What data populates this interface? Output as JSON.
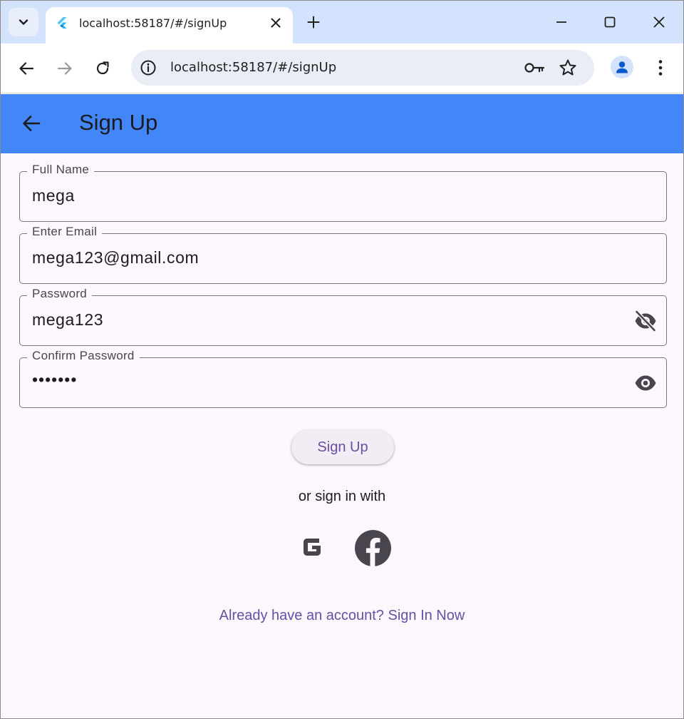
{
  "browser": {
    "tab_title": "localhost:58187/#/signUp",
    "url": "localhost:58187/#/signUp"
  },
  "appbar": {
    "title": "Sign Up",
    "color": "#4286f7"
  },
  "form": {
    "full_name": {
      "label": "Full Name",
      "value": "mega"
    },
    "email": {
      "label": "Enter Email",
      "value": "mega123@gmail.com"
    },
    "password": {
      "label": "Password",
      "value": "mega123",
      "visibility_icon": "eye-off-icon"
    },
    "confirm_password": {
      "label": "Confirm Password",
      "value": "•••••••",
      "visibility_icon": "eye-icon"
    }
  },
  "actions": {
    "signup_label": "Sign Up",
    "or_text": "or sign in with",
    "social": [
      "google-icon",
      "facebook-icon"
    ],
    "signin_link": "Already have an account? Sign In Now"
  },
  "colors": {
    "primary": "#6750a4",
    "background": "#fcf6fd",
    "outline": "#79747e"
  }
}
